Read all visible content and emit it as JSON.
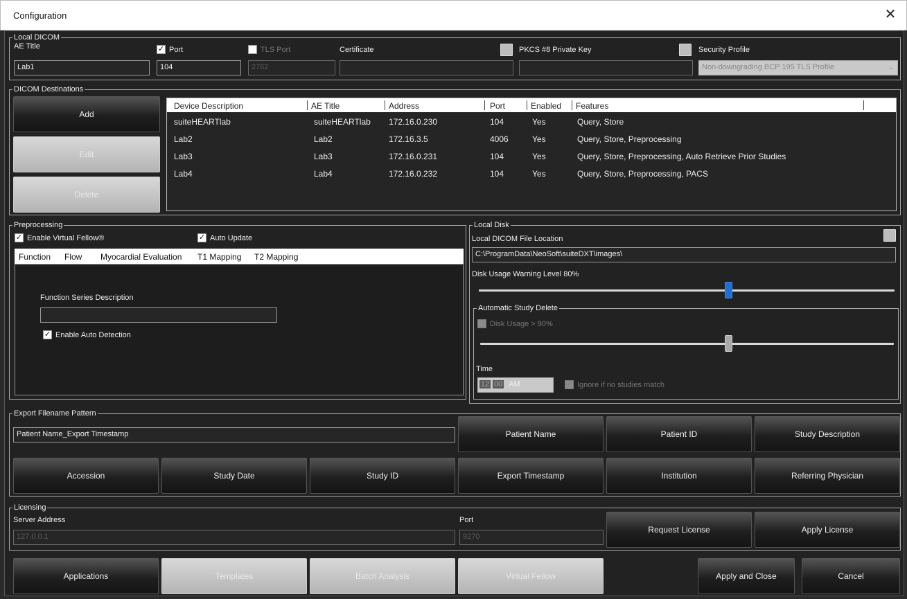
{
  "window": {
    "title": "Configuration",
    "close_glyph": "✕"
  },
  "local_dicom": {
    "group_label": "Local DICOM",
    "ae_title_label": "AE Title",
    "ae_title_value": "Lab1",
    "port_label": "Port",
    "port_checked": true,
    "port_value": "104",
    "tls_label": "TLS Port",
    "tls_value": "2762",
    "certificate_label": "Certificate",
    "certificate_value": "",
    "private_key_label": "PKCS #8 Private Key",
    "private_key_value": "",
    "security_profile_label": "Security Profile",
    "security_profile_value": "Non-downgrading BCP 195 TLS Profile"
  },
  "destinations": {
    "group_label": "DICOM Destinations",
    "add_label": "Add",
    "edit_label": "Edit",
    "delete_label": "Delete",
    "columns": [
      "Device Description",
      "AE Title",
      "Address",
      "Port",
      "Enabled",
      "Features"
    ],
    "rows": [
      [
        "suiteHEARTlab",
        "suiteHEARTlab",
        "172.16.0.230",
        "104",
        "Yes",
        "Query, Store"
      ],
      [
        "Lab2",
        "Lab2",
        "172.16.3.5",
        "4006",
        "Yes",
        "Query, Store, Preprocessing"
      ],
      [
        "Lab3",
        "Lab3",
        "172.16.0.231",
        "104",
        "Yes",
        "Query, Store, Preprocessing, Auto Retrieve Prior Studies"
      ],
      [
        "Lab4",
        "Lab4",
        "172.16.0.232",
        "104",
        "Yes",
        "Query, Store, Preprocessing, PACS"
      ]
    ]
  },
  "preprocessing": {
    "group_label": "Preprocessing",
    "enable_vf_label": "Enable Virtual Fellow®",
    "enable_vf_checked": true,
    "auto_update_label": "Auto Update",
    "auto_update_checked": true,
    "tabs": [
      "Function",
      "Flow",
      "Myocardial Evaluation",
      "T1 Mapping",
      "T2 Mapping"
    ],
    "active_tab": "Function",
    "series_desc_label": "Function Series Description",
    "series_desc_value": "",
    "auto_detect_label": "Enable Auto Detection",
    "auto_detect_checked": true
  },
  "local_disk": {
    "group_label": "Local Disk",
    "file_location_label": "Local DICOM File Location",
    "file_location_value": "C:\\ProgramData\\NeoSoft\\suiteDXT\\images\\",
    "warning_label": "Disk Usage Warning Level 80%",
    "warning_level": 0.6,
    "auto_delete_label": "Automatic Study Delete",
    "delete_at_label": "Disk Usage > 90%",
    "delete_level": 0.6,
    "time_label": "Time",
    "time_hour": "12",
    "time_min": "00",
    "time_ampm": "AM",
    "ignore_label": "Ignore if no studies match"
  },
  "export": {
    "group_label": "Export Filename Pattern",
    "pattern_value": "Patient Name_Export Timestamp",
    "buttons": [
      "Patient Name",
      "Patient ID",
      "Study Description",
      "Accession",
      "Study Date",
      "Study ID",
      "Export Timestamp",
      "Institution",
      "Referring Physician"
    ]
  },
  "licensing": {
    "group_label": "Licensing",
    "server_label": "Server Address",
    "server_value": "127.0.0.1",
    "port_label": "Port",
    "port_value": "9270",
    "request_label": "Request License",
    "apply_label": "Apply License"
  },
  "footer": {
    "applications": "Applications",
    "templates": "Templates",
    "batch_analysis": "Batch Analysis",
    "virtual_fellow": "Virtual Fellow",
    "apply_close": "Apply and Close",
    "cancel": "Cancel"
  }
}
